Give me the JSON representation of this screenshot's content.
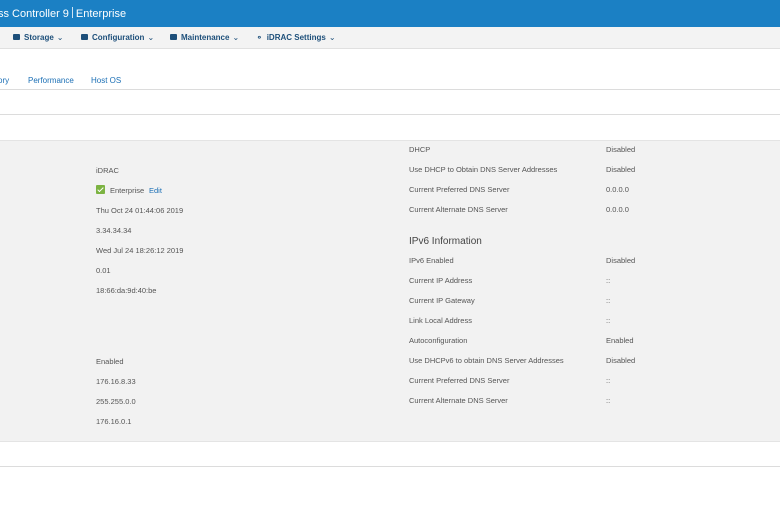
{
  "header": {
    "title_left": "ss Controller 9",
    "title_right": "Enterprise"
  },
  "menu": [
    {
      "label": "Storage"
    },
    {
      "label": "Configuration"
    },
    {
      "label": "Maintenance"
    },
    {
      "label": "iDRAC Settings"
    }
  ],
  "tabs": [
    "ory",
    "Performance",
    "Host OS"
  ],
  "left_values": {
    "v1": "iDRAC",
    "license": "Enterprise",
    "edit": "Edit",
    "v3": "Thu Oct 24 01:44:06 2019",
    "v4": "3.34.34.34",
    "v5": "Wed Jul 24 18:26:12 2019",
    "v6": "0.01",
    "v7": "18:66:da:9d:40:be",
    "v8": "Enabled",
    "v9": "176.16.8.33",
    "v10": "255.255.0.0",
    "v11": "176.16.0.1"
  },
  "ipv4_rows": [
    {
      "label": "DHCP",
      "value": "Disabled"
    },
    {
      "label": "Use DHCP to Obtain DNS Server Addresses",
      "value": "Disabled"
    },
    {
      "label": "Current Preferred DNS Server",
      "value": "0.0.0.0"
    },
    {
      "label": "Current Alternate DNS Server",
      "value": "0.0.0.0"
    }
  ],
  "ipv6": {
    "title": "IPv6 Information",
    "rows": [
      {
        "label": "IPv6 Enabled",
        "value": "Disabled"
      },
      {
        "label": "Current IP Address",
        "value": "::"
      },
      {
        "label": "Current IP Gateway",
        "value": "::"
      },
      {
        "label": "Link Local Address",
        "value": "::"
      },
      {
        "label": "Autoconfiguration",
        "value": "Enabled"
      },
      {
        "label": "Use DHCPv6 to obtain DNS Server Addresses",
        "value": "Disabled"
      },
      {
        "label": "Current Preferred DNS Server",
        "value": "::"
      },
      {
        "label": "Current Alternate DNS Server",
        "value": "::"
      }
    ]
  }
}
